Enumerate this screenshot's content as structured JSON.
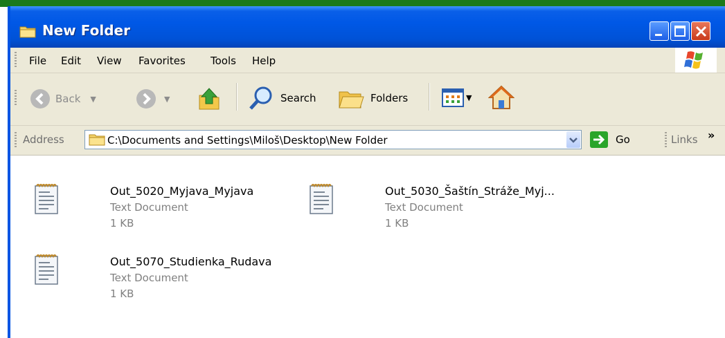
{
  "window": {
    "title": "New Folder",
    "accent": "#0054e3"
  },
  "menu": [
    "File",
    "Edit",
    "View",
    "Favorites",
    "Tools",
    "Help"
  ],
  "toolbar": {
    "back_label": "Back",
    "search_label": "Search",
    "folders_label": "Folders",
    "icons": [
      "back-arrow-icon",
      "forward-arrow-icon",
      "up-folder-icon",
      "search-icon",
      "folders-icon",
      "views-icon",
      "home-icon"
    ]
  },
  "address": {
    "label": "Address",
    "path": "C:\\Documents and Settings\\Miloš\\Desktop\\New Folder",
    "go_label": "Go",
    "links_label": "Links",
    "more": "»"
  },
  "files": [
    {
      "name": "Out_5020_Myjava_Myjava",
      "type": "Text Document",
      "size": "1 KB"
    },
    {
      "name": "Out_5030_Šaštín_Stráže_Myj...",
      "type": "Text Document",
      "size": "1 KB"
    },
    {
      "name": "Out_5070_Studienka_Rudava",
      "type": "Text Document",
      "size": "1 KB"
    }
  ]
}
